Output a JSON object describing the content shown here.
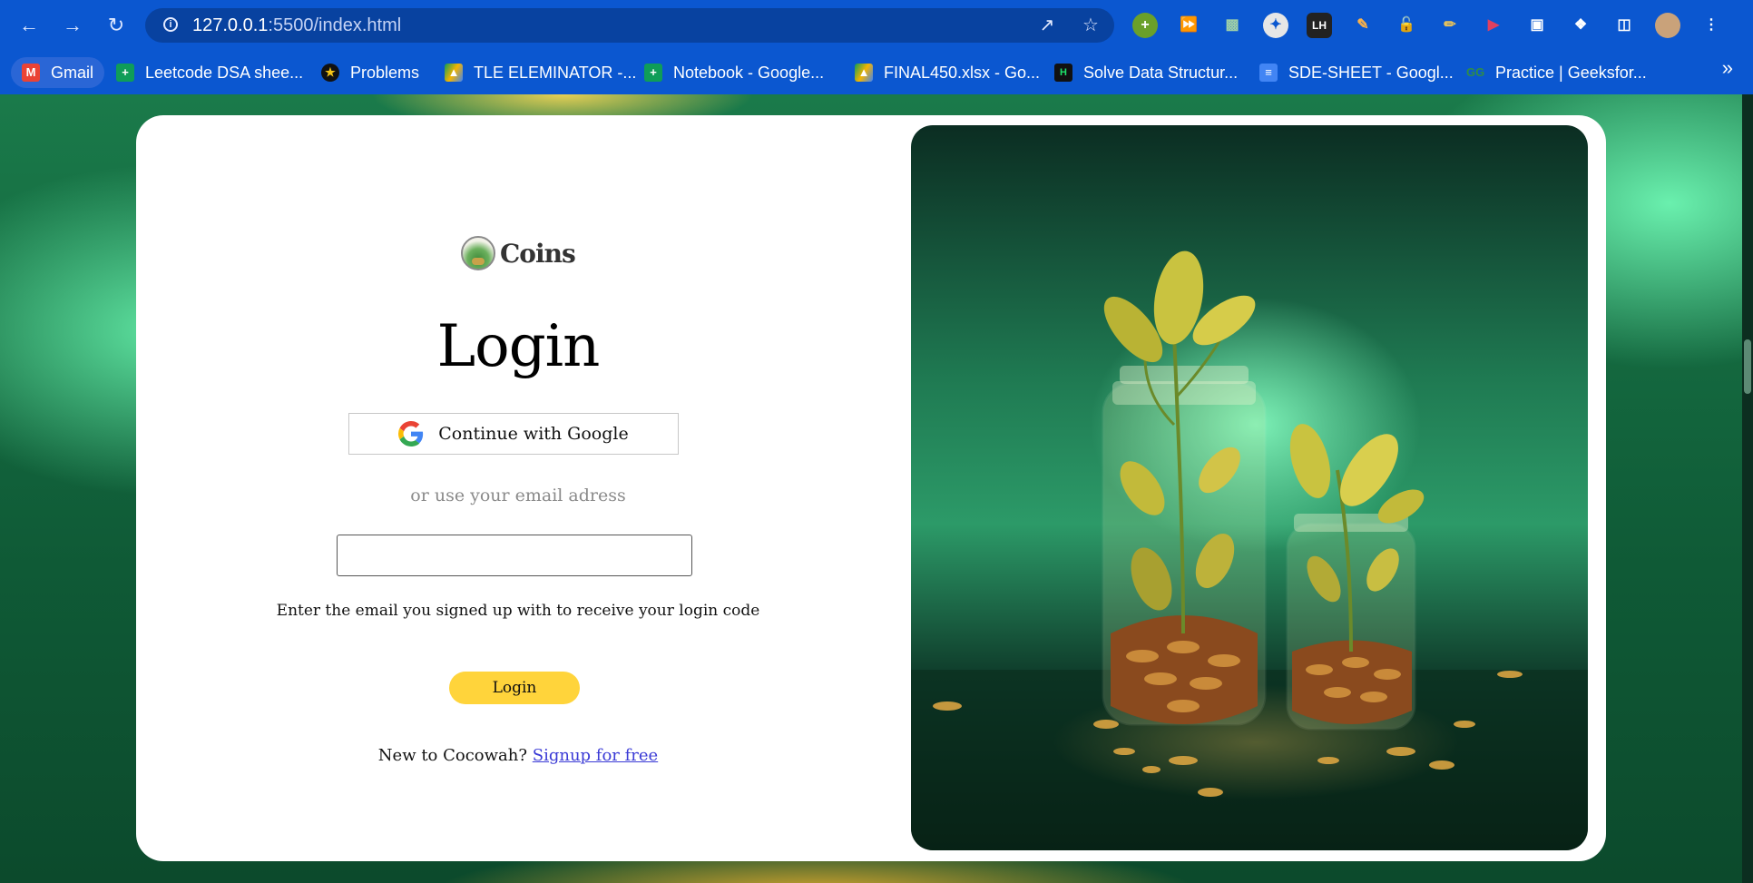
{
  "browser": {
    "url_host": "127.0.0.1",
    "url_path": ":5500/index.html",
    "bookmarks": [
      {
        "label": "Gmail",
        "icon": "gmail-icon"
      },
      {
        "label": "Leetcode DSA shee...",
        "icon": "sheets-icon"
      },
      {
        "label": "Problems",
        "icon": "codeforces-icon"
      },
      {
        "label": "TLE ELEMINATOR -...",
        "icon": "drive-icon"
      },
      {
        "label": "Notebook - Google...",
        "icon": "sheets-icon"
      },
      {
        "label": "FINAL450.xlsx - Go...",
        "icon": "drive-icon"
      },
      {
        "label": "Solve Data Structur...",
        "icon": "hackerrank-icon"
      },
      {
        "label": "SDE-SHEET - Googl...",
        "icon": "docs-icon"
      },
      {
        "label": "Practice | Geeksfor...",
        "icon": "gfg-icon"
      }
    ],
    "more_bookmarks": "»"
  },
  "login": {
    "brand_name": "Coins",
    "title": "Login",
    "google_button": "Continue with Google",
    "or_text": "or use your email adress",
    "email_value": "",
    "hint": "Enter the email you signed up with to receive your login code",
    "login_button": "Login",
    "signup_prompt": "New to Cocowah?",
    "signup_link": "Signup for free"
  },
  "colors": {
    "chrome": "#0b57d0",
    "login_button": "#ffd43b",
    "link": "#3b3bd6"
  }
}
